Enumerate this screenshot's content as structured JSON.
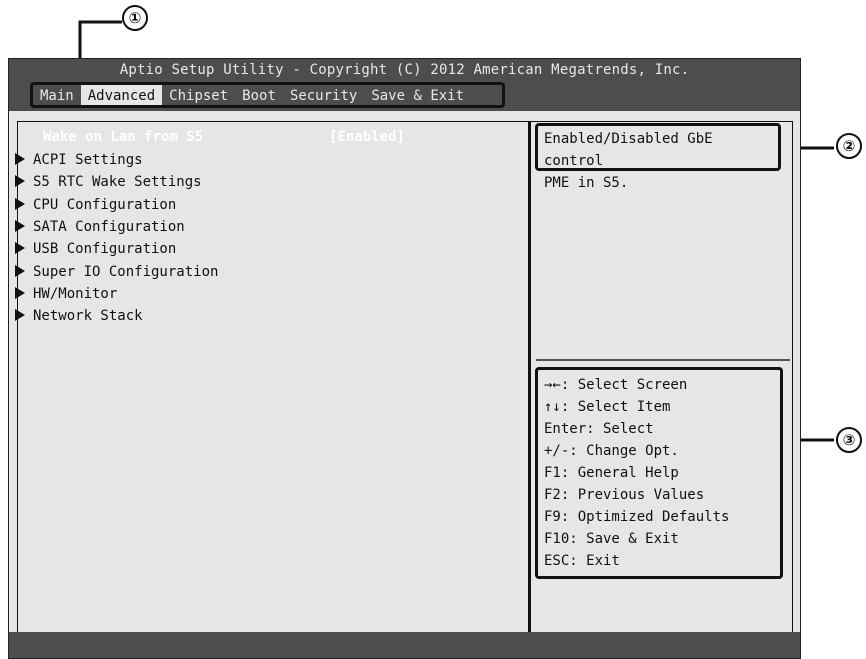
{
  "callouts": {
    "menu": "①",
    "help": "②",
    "keys": "③"
  },
  "title": "Aptio Setup Utility - Copyright (C) 2012 American Megatrends, Inc.",
  "menu": [
    {
      "label": "Main",
      "active": false
    },
    {
      "label": "Advanced",
      "active": true
    },
    {
      "label": "Chipset",
      "active": false
    },
    {
      "label": "Boot",
      "active": false
    },
    {
      "label": "Security",
      "active": false
    },
    {
      "label": "Save & Exit",
      "active": false
    }
  ],
  "settings": {
    "wake_label": "Wake on Lan from S5",
    "wake_value": "[Enabled]",
    "items": [
      "ACPI Settings",
      "S5 RTC Wake Settings",
      "CPU Configuration",
      "SATA Configuration",
      "USB Configuration",
      "Super IO Configuration",
      "HW/Monitor",
      "Network Stack"
    ]
  },
  "help": {
    "line1": "Enabled/Disabled GbE control",
    "line2": "PME in S5."
  },
  "keys": [
    "→←: Select Screen",
    "↑↓: Select Item",
    "Enter: Select",
    "+/-: Change Opt.",
    "F1: General Help",
    "F2: Previous Values",
    "F9: Optimized Defaults",
    "F10: Save & Exit",
    "ESC: Exit"
  ],
  "colors": {
    "bar": "#4d4d4d",
    "panel": "#e6e6e6",
    "highlight_text": "#ffffff"
  }
}
